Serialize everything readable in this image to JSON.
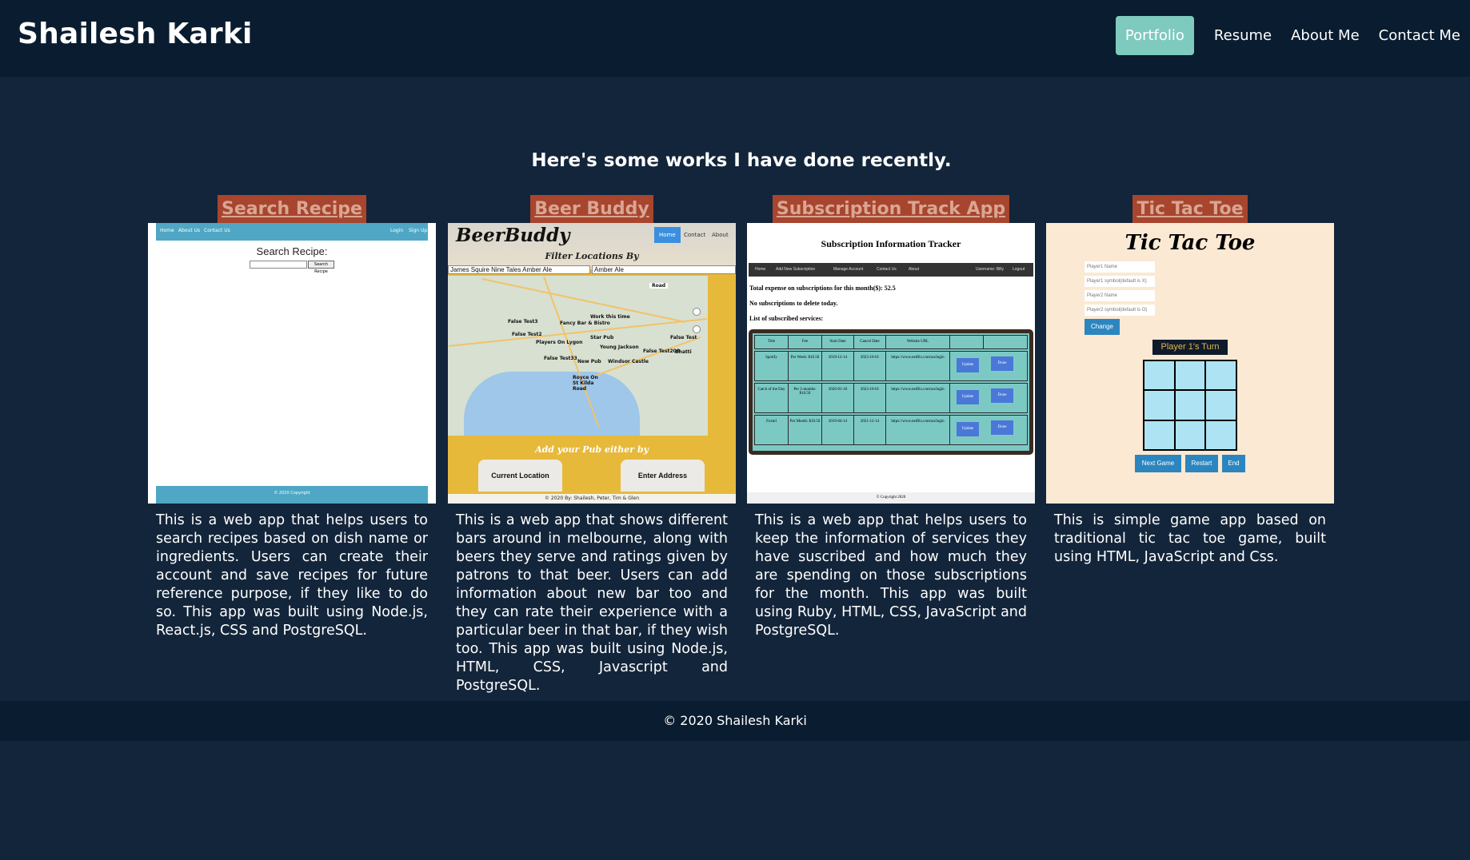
{
  "header": {
    "brand": "Shailesh Karki",
    "nav": [
      {
        "label": "Portfolio",
        "active": true
      },
      {
        "label": "Resume"
      },
      {
        "label": "About Me"
      },
      {
        "label": "Contact Me"
      }
    ]
  },
  "intro": "Here's some works I have done recently.",
  "projects": [
    {
      "title": "Search Recipe",
      "description": "This is a web app that helps users to search recipes based on dish name or ingredients. Users can create their account and save recipes for future reference purpose, if they like to do so. This app was built using Node.js, React.js, CSS and PostgreSQL.",
      "preview": {
        "nav_left": [
          "Home",
          "About Us",
          "Contact Us"
        ],
        "nav_right": [
          "Login",
          "Sign Up"
        ],
        "heading": "Search Recipe:",
        "button": "Search Recipe",
        "footer": "© 2020 Copyright"
      }
    },
    {
      "title": "Beer Buddy",
      "description": "This is a web app that shows different bars around in melbourne, along with beers they serve and ratings given by patrons to that beer. Users can add information about new bar too and they can rate their experience with a particular beer in that bar, if they wish too. This app was built using Node.js, HTML, CSS, Javascript and PostgreSQL.",
      "preview": {
        "logo": "BeerBuddy",
        "nav": [
          "Home",
          "Contact",
          "About"
        ],
        "filter_heading": "Filter Locations By",
        "select1": "James Squire Nine Tales Amber Ale",
        "select2": "Amber Ale",
        "map_toggle": "Road",
        "map_labels": [
          "False Test3",
          "Fancy Bar & Bistro",
          "Work this time",
          "False Test2",
          "Star Pub",
          "Players On Lygon",
          "Young Jackson",
          "False Test",
          "False Test200",
          "Bhatti",
          "False Test33",
          "New Pub",
          "Windsor Castle",
          "Royce On St Kilda Road"
        ],
        "add_heading": "Add your Pub either by",
        "tab1": "Current Location",
        "tab2": "Enter Address",
        "footer": "© 2020 By: Shailesh, Peter, Tim & Glen"
      }
    },
    {
      "title": "Subscription Track App",
      "description": "This is a web app that helps users to keep the information of services they have suscribed and how much they are spending on those subscriptions for the month. This app was built using Ruby, HTML, CSS, JavaScript and PostgreSQL.",
      "preview": {
        "heading": "Subscription Information Tracker",
        "nav": [
          "Home",
          "Add New Subscription",
          "Manage Account",
          "Contact Us",
          "About"
        ],
        "user": "Username: Billy",
        "logout": "Logout",
        "line1": "Total expense on subscriptions for this month($): 52.5",
        "line2": "No subscriptions to delete today.",
        "line3": "List of subscribed services:",
        "columns": [
          "Title",
          "Fee",
          "Start Date",
          "Cancel Date",
          "Website URL"
        ],
        "rows": [
          [
            "Spotify",
            "Per Week: $10.50",
            "2019-12-14",
            "2023-10-01",
            "https://www.netflix.com/au/login"
          ],
          [
            "Catch of the Day",
            "Per 2-months: $10.50",
            "2020-01-10",
            "2023-10-01",
            "https://www.netflix.com/au/login"
          ],
          [
            "Foxtel",
            "Per Month: $10.50",
            "2019-04-14",
            "2021-12-14",
            "https://www.netflix.com/au/login"
          ]
        ],
        "update_label": "Update",
        "done_label": "Done",
        "footer": "© Copyright 2020"
      }
    },
    {
      "title": "Tic Tac Toe",
      "description": "This is simple game app based on traditional tic tac toe game, built using HTML, JavaScript and Css.",
      "preview": {
        "heading": "Tic Tac Toe",
        "fields": [
          "Player1 Name",
          "Player1 symbol(default is X)",
          "Player2 Name",
          "Player2 symbol(default is O)"
        ],
        "change": "Change",
        "turn": "Player 1's Turn",
        "buttons": [
          "Next Game",
          "Restart",
          "End"
        ]
      }
    }
  ],
  "footer": "© 2020 Shailesh Karki"
}
